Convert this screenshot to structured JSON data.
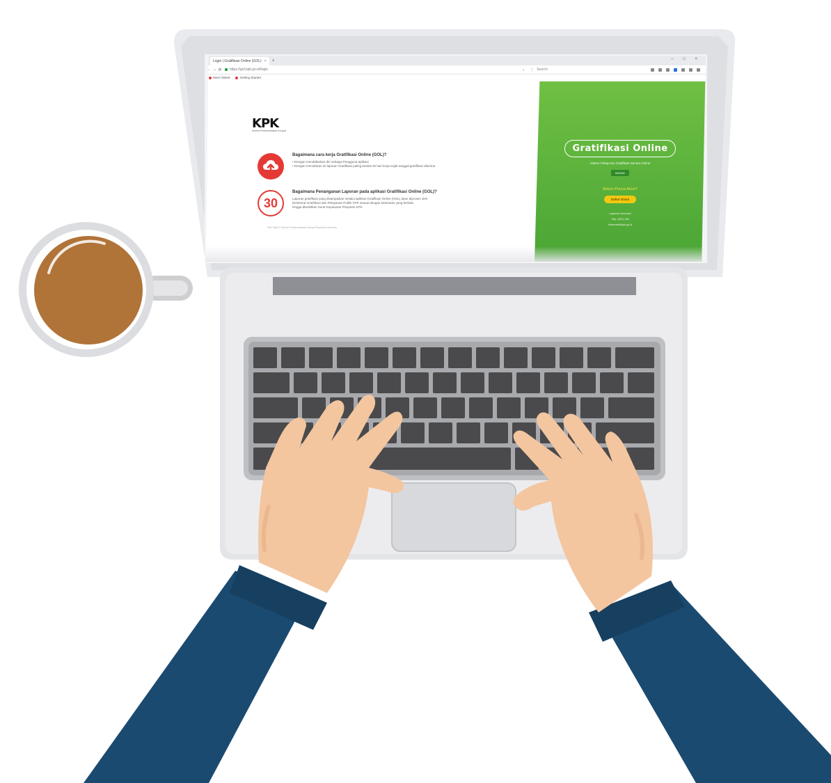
{
  "browser": {
    "tab_title": "Login | Gratifikasi Online (GOL)",
    "tab_close": "×",
    "new_tab": "+",
    "window_controls": "– □ ×",
    "back": "←",
    "forward": "→",
    "reload": "⟳",
    "url": "https://gol.kpk.go.id/login",
    "url_menu": "⌄",
    "search_placeholder": "Search",
    "bookmarks": [
      "Most Visited",
      "Getting Started"
    ]
  },
  "site": {
    "logo_text": "KPK",
    "logo_subtitle": "Komisi Pemberantasan Korupsi",
    "question1": {
      "title": "Bagaimana cara kerja Gratifikasi Online (GOL)?",
      "lines": [
        "• Dengan mendaftarkan diri sebagai Pengguna aplikasi",
        "• Dengan menuliskan Isi laporan Gratifikasi paling lambat 30 hari kerja sejak tanggal gratifikasi diterima"
      ]
    },
    "question2": {
      "badge": "30",
      "title": "Bagaimana Penanganan Laporan pada aplikasi Gratifikasi Online (GOL)?",
      "lines": [
        "Laporan gratifikasi yang disampaikan melalui aplikasi Gratifikasi Online (GOL) akan diproses oleh",
        "Direktorat Gratifikasi dan Pelayanan Publik KPK sesuai dengan ketentuan yang berlaku",
        "hingga diterbitkan Surat Keputusan Pimpinan KPK"
      ]
    },
    "footnote": "Hak Cipta © Komisi Pemberantasan Korupsi Republik Indonesia",
    "panel": {
      "brand": "Gratifikasi Online",
      "tagline": "Sistem Pelaporan Gratifikasi Secara Online",
      "mini_button": "MASUK",
      "prompt": "Belum Punya Akun?",
      "register_button": "Daftar Disini",
      "contact": [
        "Layanan Informasi",
        "Telp. (021) 198",
        "informasi@kpk.go.id"
      ]
    }
  }
}
